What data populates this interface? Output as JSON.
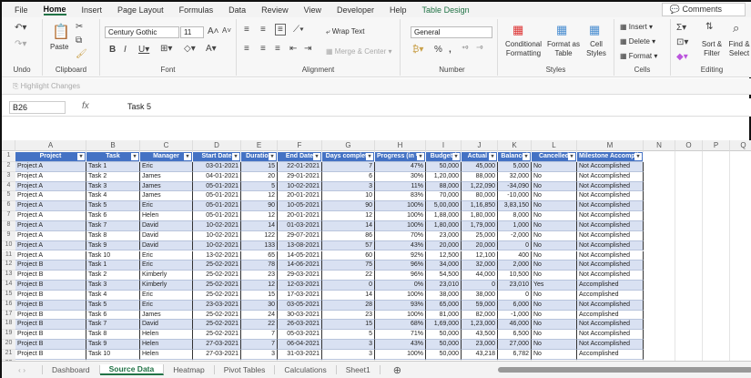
{
  "menu": {
    "tabs": [
      "File",
      "Home",
      "Insert",
      "Page Layout",
      "Formulas",
      "Data",
      "Review",
      "View",
      "Developer",
      "Help",
      "Table Design"
    ],
    "comments": "Comments"
  },
  "ribbon": {
    "undo": "Undo",
    "clipboard": "Clipboard",
    "paste": "Paste",
    "font_group": "Font",
    "font_name": "Century Gothic",
    "font_size": "11",
    "alignment": "Alignment",
    "wrap_text": "Wrap Text",
    "merge_center": "Merge & Center",
    "number": "Number",
    "number_format": "General",
    "styles": "Styles",
    "conditional_formatting": "Conditional Formatting",
    "format_as_table": "Format as Table",
    "cell_styles": "Cell Styles",
    "cells": "Cells",
    "insert": "Insert",
    "delete": "Delete",
    "format": "Format",
    "editing": "Editing",
    "sort_filter": "Sort & Filter",
    "find_select": "Find & Select"
  },
  "highlight_changes": "Highlight Changes",
  "formula_bar": {
    "name_box": "B26",
    "fx": "fx",
    "value": "Task 5"
  },
  "columns": [
    "A",
    "B",
    "C",
    "D",
    "E",
    "F",
    "G",
    "H",
    "I",
    "J",
    "K",
    "L",
    "M",
    "N",
    "O",
    "P",
    "Q"
  ],
  "headers": [
    "Project",
    "Task",
    "Manager",
    "Start Date",
    "Duration",
    "End Date",
    "Days complete",
    "Progress (in %)",
    "Budget (",
    "Actual (",
    "Balance(",
    "Cancelled",
    "Milestone Accomplis"
  ],
  "rows": [
    [
      "Project A",
      "Task 1",
      "Eric",
      "03-01-2021",
      "15",
      "22-01-2021",
      "7",
      "47%",
      "50,000",
      "45,000",
      "5,000",
      "No",
      "Not Accomplished"
    ],
    [
      "Project A",
      "Task 2",
      "James",
      "04-01-2021",
      "20",
      "29-01-2021",
      "6",
      "30%",
      "1,20,000",
      "88,000",
      "32,000",
      "No",
      "Not Accomplished"
    ],
    [
      "Project A",
      "Task 3",
      "James",
      "05-01-2021",
      "5",
      "10-02-2021",
      "3",
      "11%",
      "88,000",
      "1,22,090",
      "-34,090",
      "No",
      "Not Accomplished"
    ],
    [
      "Project A",
      "Task 4",
      "James",
      "05-01-2021",
      "12",
      "20-01-2021",
      "10",
      "83%",
      "70,000",
      "80,000",
      "-10,000",
      "No",
      "Not Accomplished"
    ],
    [
      "Project A",
      "Task 5",
      "Eric",
      "05-01-2021",
      "90",
      "10-05-2021",
      "90",
      "100%",
      "5,00,000",
      "1,16,850",
      "3,83,150",
      "No",
      "Not Accomplished"
    ],
    [
      "Project A",
      "Task 6",
      "Helen",
      "05-01-2021",
      "12",
      "20-01-2021",
      "12",
      "100%",
      "1,88,000",
      "1,80,000",
      "8,000",
      "No",
      "Not Accomplished"
    ],
    [
      "Project A",
      "Task 7",
      "David",
      "10-02-2021",
      "14",
      "01-03-2021",
      "14",
      "100%",
      "1,80,000",
      "1,79,000",
      "1,000",
      "No",
      "Not Accomplished"
    ],
    [
      "Project A",
      "Task 8",
      "David",
      "10-02-2021",
      "122",
      "29-07-2021",
      "86",
      "70%",
      "23,000",
      "25,000",
      "-2,000",
      "No",
      "Not Accomplished"
    ],
    [
      "Project A",
      "Task 9",
      "David",
      "10-02-2021",
      "133",
      "13-08-2021",
      "57",
      "43%",
      "20,000",
      "20,000",
      "0",
      "No",
      "Not Accomplished"
    ],
    [
      "Project A",
      "Task 10",
      "Eric",
      "13-02-2021",
      "65",
      "14-05-2021",
      "60",
      "92%",
      "12,500",
      "12,100",
      "400",
      "No",
      "Not Accomplished"
    ],
    [
      "Project B",
      "Task 1",
      "Eric",
      "25-02-2021",
      "78",
      "14-06-2021",
      "75",
      "96%",
      "34,000",
      "32,000",
      "2,000",
      "No",
      "Not Accomplished"
    ],
    [
      "Project B",
      "Task 2",
      "Kimberly",
      "25-02-2021",
      "23",
      "29-03-2021",
      "22",
      "96%",
      "54,500",
      "44,000",
      "10,500",
      "No",
      "Not Accomplished"
    ],
    [
      "Project B",
      "Task 3",
      "Kimberly",
      "25-02-2021",
      "12",
      "12-03-2021",
      "0",
      "0%",
      "23,010",
      "0",
      "23,010",
      "Yes",
      "Accomplished"
    ],
    [
      "Project B",
      "Task 4",
      "Eric",
      "25-02-2021",
      "15",
      "17-03-2021",
      "14",
      "100%",
      "38,000",
      "38,000",
      "0",
      "No",
      "Accomplished"
    ],
    [
      "Project B",
      "Task 5",
      "Eric",
      "23-03-2021",
      "30",
      "03-05-2021",
      "28",
      "93%",
      "65,000",
      "59,000",
      "6,000",
      "No",
      "Not Accomplished"
    ],
    [
      "Project B",
      "Task 6",
      "James",
      "25-02-2021",
      "24",
      "30-03-2021",
      "23",
      "100%",
      "81,000",
      "82,000",
      "-1,000",
      "No",
      "Accomplished"
    ],
    [
      "Project B",
      "Task 7",
      "David",
      "25-02-2021",
      "22",
      "26-03-2021",
      "15",
      "68%",
      "1,69,000",
      "1,23,000",
      "46,000",
      "No",
      "Not Accomplished"
    ],
    [
      "Project B",
      "Task 8",
      "Helen",
      "25-02-2021",
      "7",
      "05-03-2021",
      "5",
      "71%",
      "50,000",
      "43,500",
      "6,500",
      "No",
      "Not Accomplished"
    ],
    [
      "Project B",
      "Task 9",
      "Helen",
      "27-03-2021",
      "7",
      "06-04-2021",
      "3",
      "43%",
      "50,000",
      "23,000",
      "27,000",
      "No",
      "Not Accomplished"
    ],
    [
      "Project B",
      "Task 10",
      "Helen",
      "27-03-2021",
      "3",
      "31-03-2021",
      "3",
      "100%",
      "50,000",
      "43,218",
      "6,782",
      "No",
      "Accomplished"
    ]
  ],
  "sheets": [
    "Dashboard",
    "Source Data",
    "Heatmap",
    "Pivot Tables",
    "Calculations",
    "Sheet1"
  ],
  "active_sheet": "Source Data",
  "colors": {
    "header": "#4472c4",
    "band": "#d9e1f2",
    "accent": "#217346"
  }
}
